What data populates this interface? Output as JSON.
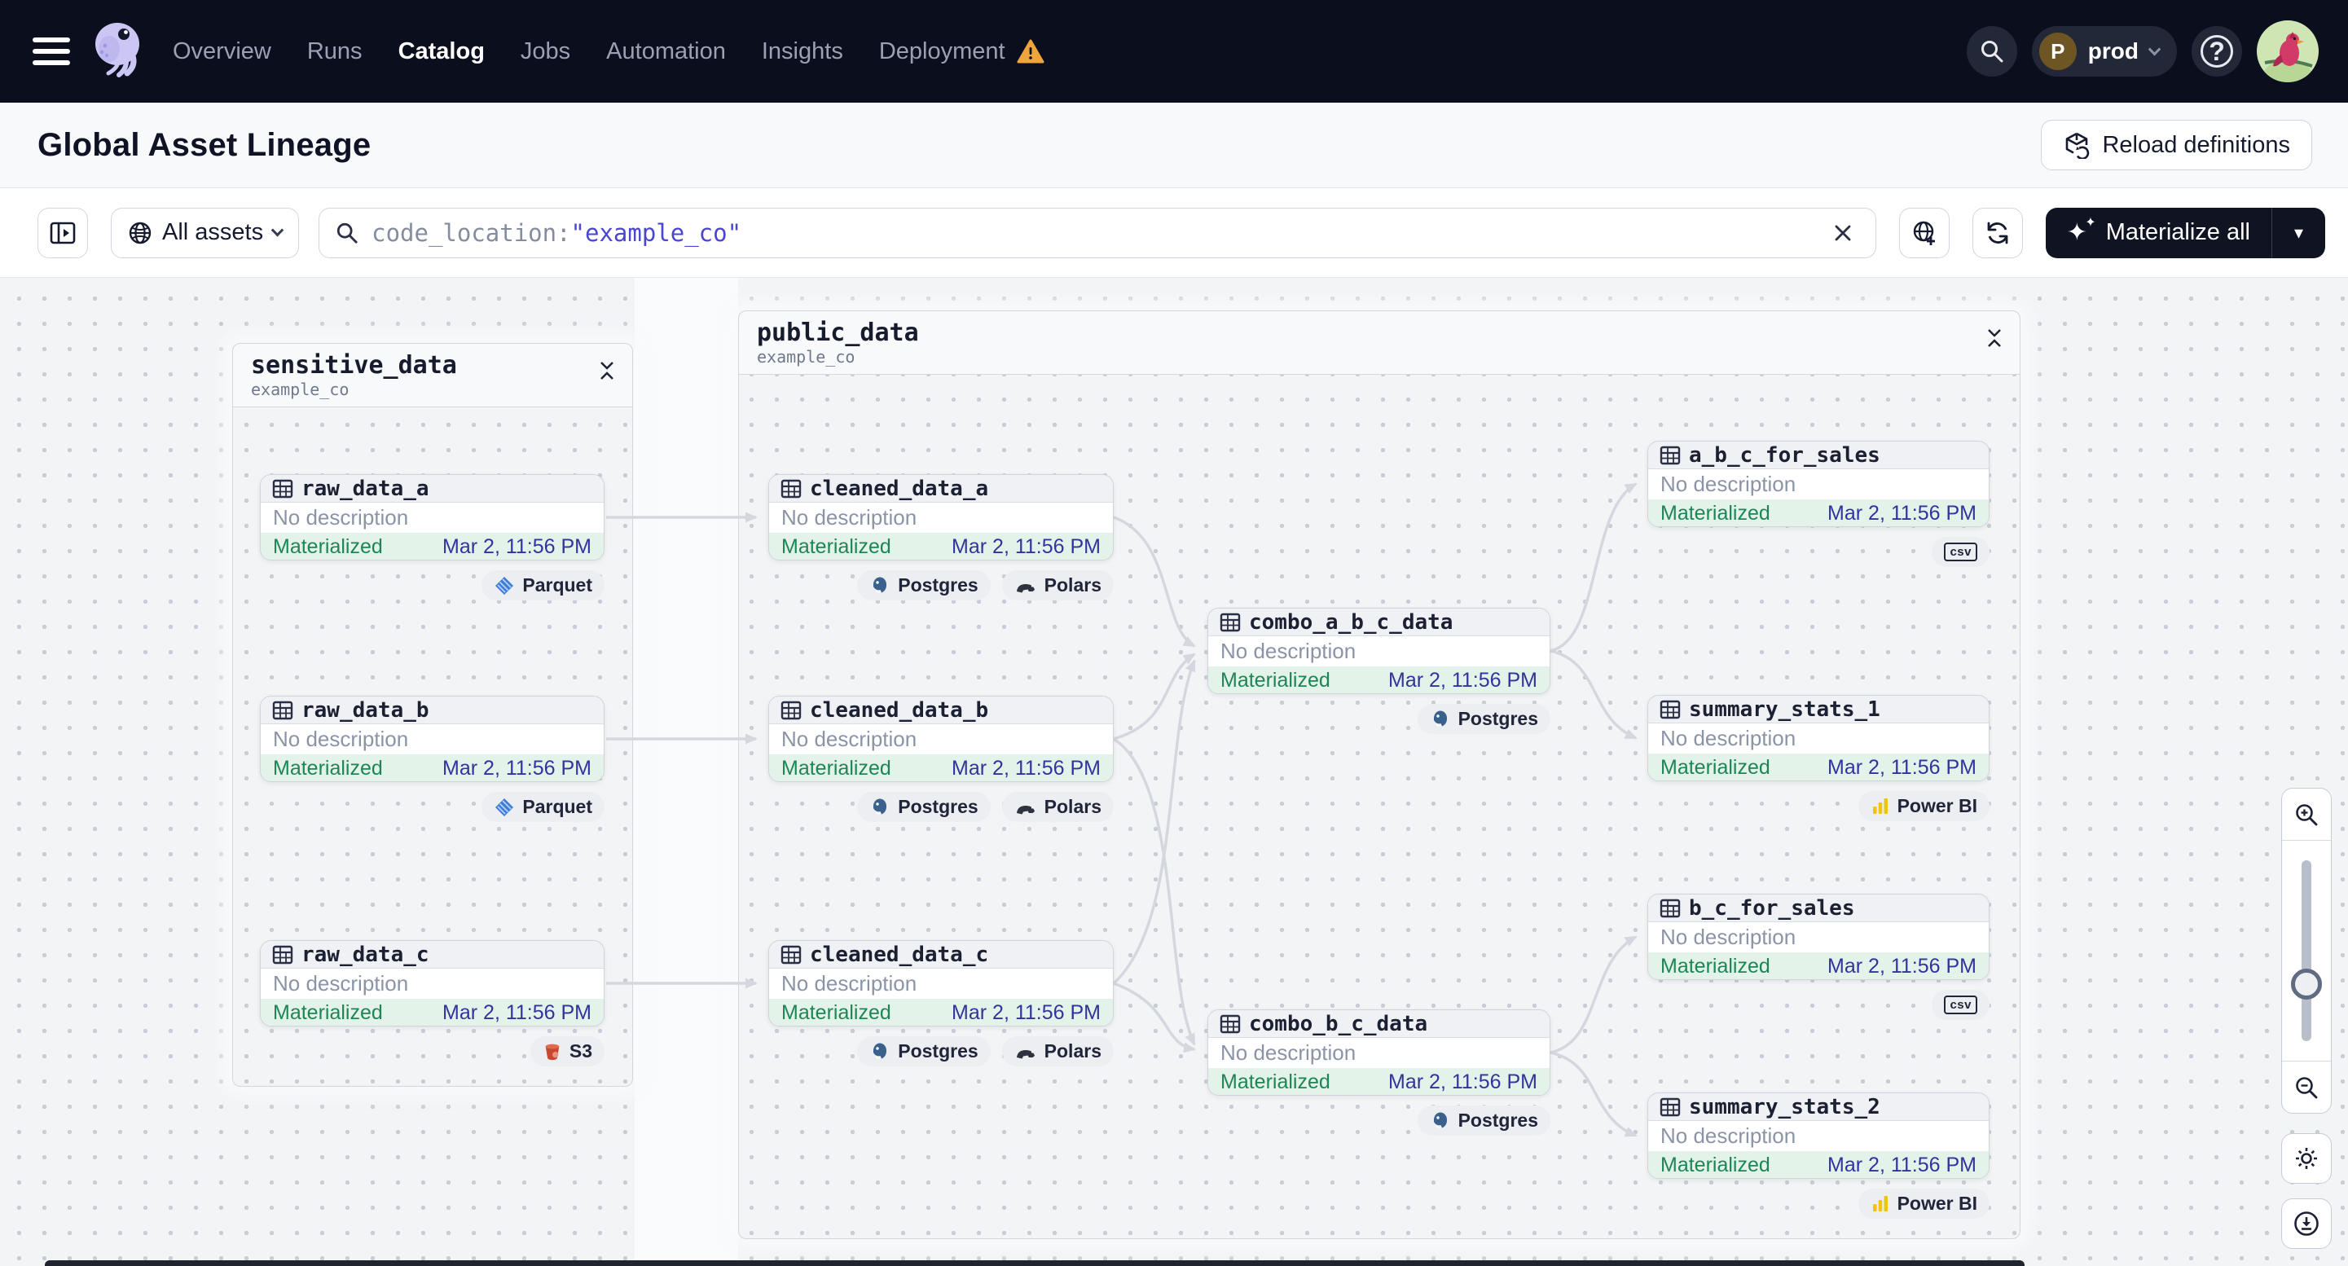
{
  "topnav": {
    "items": [
      {
        "label": "Overview",
        "active": false
      },
      {
        "label": "Runs",
        "active": false
      },
      {
        "label": "Catalog",
        "active": true
      },
      {
        "label": "Jobs",
        "active": false
      },
      {
        "label": "Automation",
        "active": false
      },
      {
        "label": "Insights",
        "active": false
      },
      {
        "label": "Deployment",
        "active": false,
        "warning": true
      }
    ],
    "environment": {
      "initial": "P",
      "name": "prod"
    },
    "icons": {
      "help": "?"
    }
  },
  "page_header": {
    "title": "Global Asset Lineage",
    "reload_button": "Reload definitions"
  },
  "toolbar": {
    "scope_filter": {
      "label": "All assets"
    },
    "search": {
      "prefix": "code_location:",
      "value": "\"example_co\""
    },
    "materialize_button": "Materialize all",
    "sparkle_glyph": "✦",
    "caret_glyph": "▾"
  },
  "graph": {
    "groups": [
      {
        "name": "sensitive_data",
        "code_location": "example_co"
      },
      {
        "name": "public_data",
        "code_location": "example_co"
      }
    ],
    "nodes": [
      {
        "name": "raw_data_a",
        "description": "No description",
        "status": "Materialized",
        "materialized_at": "Mar 2, 11:56 PM",
        "tags": [
          {
            "label": "Parquet",
            "icon": "parquet-icon"
          }
        ]
      },
      {
        "name": "raw_data_b",
        "description": "No description",
        "status": "Materialized",
        "materialized_at": "Mar 2, 11:56 PM",
        "tags": [
          {
            "label": "Parquet",
            "icon": "parquet-icon"
          }
        ]
      },
      {
        "name": "raw_data_c",
        "description": "No description",
        "status": "Materialized",
        "materialized_at": "Mar 2, 11:56 PM",
        "tags": [
          {
            "label": "S3",
            "icon": "s3-icon"
          }
        ]
      },
      {
        "name": "cleaned_data_a",
        "description": "No description",
        "status": "Materialized",
        "materialized_at": "Mar 2, 11:56 PM",
        "tags": [
          {
            "label": "Postgres",
            "icon": "postgres-icon"
          },
          {
            "label": "Polars",
            "icon": "polars-icon"
          }
        ]
      },
      {
        "name": "cleaned_data_b",
        "description": "No description",
        "status": "Materialized",
        "materialized_at": "Mar 2, 11:56 PM",
        "tags": [
          {
            "label": "Postgres",
            "icon": "postgres-icon"
          },
          {
            "label": "Polars",
            "icon": "polars-icon"
          }
        ]
      },
      {
        "name": "cleaned_data_c",
        "description": "No description",
        "status": "Materialized",
        "materialized_at": "Mar 2, 11:56 PM",
        "tags": [
          {
            "label": "Postgres",
            "icon": "postgres-icon"
          },
          {
            "label": "Polars",
            "icon": "polars-icon"
          }
        ]
      },
      {
        "name": "combo_a_b_c_data",
        "description": "No description",
        "status": "Materialized",
        "materialized_at": "Mar 2, 11:56 PM",
        "tags": [
          {
            "label": "Postgres",
            "icon": "postgres-icon"
          }
        ]
      },
      {
        "name": "combo_b_c_data",
        "description": "No description",
        "status": "Materialized",
        "materialized_at": "Mar 2, 11:56 PM",
        "tags": [
          {
            "label": "Postgres",
            "icon": "postgres-icon"
          }
        ]
      },
      {
        "name": "a_b_c_for_sales",
        "description": "No description",
        "status": "Materialized",
        "materialized_at": "Mar 2, 11:56 PM",
        "tags": [
          {
            "label": "csv",
            "icon": "csv-icon"
          }
        ]
      },
      {
        "name": "summary_stats_1",
        "description": "No description",
        "status": "Materialized",
        "materialized_at": "Mar 2, 11:56 PM",
        "tags": [
          {
            "label": "Power BI",
            "icon": "powerbi-icon"
          }
        ]
      },
      {
        "name": "b_c_for_sales",
        "description": "No description",
        "status": "Materialized",
        "materialized_at": "Mar 2, 11:56 PM",
        "tags": [
          {
            "label": "csv",
            "icon": "csv-icon"
          }
        ]
      },
      {
        "name": "summary_stats_2",
        "description": "No description",
        "status": "Materialized",
        "materialized_at": "Mar 2, 11:56 PM",
        "tags": [
          {
            "label": "Power BI",
            "icon": "powerbi-icon"
          }
        ]
      }
    ],
    "edges": [
      {
        "from": "raw_data_a",
        "to": "cleaned_data_a"
      },
      {
        "from": "raw_data_b",
        "to": "cleaned_data_b"
      },
      {
        "from": "raw_data_c",
        "to": "cleaned_data_c"
      },
      {
        "from": "cleaned_data_a",
        "to": "combo_a_b_c_data"
      },
      {
        "from": "cleaned_data_b",
        "to": "combo_a_b_c_data"
      },
      {
        "from": "cleaned_data_b",
        "to": "combo_b_c_data"
      },
      {
        "from": "cleaned_data_c",
        "to": "combo_a_b_c_data"
      },
      {
        "from": "cleaned_data_c",
        "to": "combo_b_c_data"
      },
      {
        "from": "combo_a_b_c_data",
        "to": "a_b_c_for_sales"
      },
      {
        "from": "combo_a_b_c_data",
        "to": "summary_stats_1"
      },
      {
        "from": "combo_b_c_data",
        "to": "b_c_for_sales"
      },
      {
        "from": "combo_b_c_data",
        "to": "summary_stats_2"
      }
    ]
  },
  "colors": {
    "topbar_bg": "#0a0e1d",
    "materialized_text": "#1e8555",
    "materialized_bg": "#e3f3ea",
    "timestamp_text": "#33339e",
    "search_term": "#4a46cf",
    "warning_amber": "#f0a43c",
    "edge_gray": "#d4d7de",
    "env_badge_brown": "#6d5524"
  }
}
